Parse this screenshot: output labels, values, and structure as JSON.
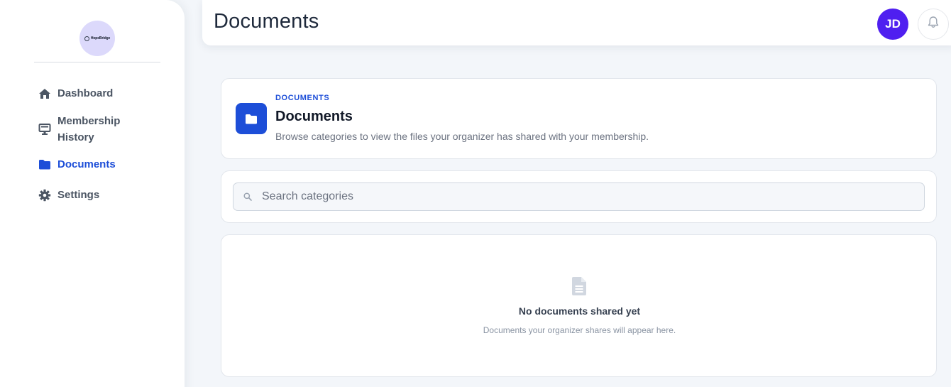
{
  "sidebar": {
    "logo_text": "HopeBridge",
    "items": [
      {
        "label": "Dashboard",
        "icon": "home-icon"
      },
      {
        "label": "Membership History",
        "icon": "monitor-icon"
      },
      {
        "label": "Documents",
        "icon": "folder-icon",
        "active": true
      },
      {
        "label": "Settings",
        "icon": "gear-icon"
      }
    ]
  },
  "header": {
    "title": "Documents",
    "avatar_initials": "JD",
    "notification_icon": "bell-icon"
  },
  "documents_card": {
    "eyebrow": "DOCUMENTS",
    "title": "Documents",
    "subtitle": "Browse categories to view the files your organizer has shared with your membership.",
    "icon": "folder-icon"
  },
  "search": {
    "placeholder": "Search categories",
    "value": "",
    "icon": "search-icon"
  },
  "empty_state": {
    "icon": "document-icon",
    "title": "No documents shared yet",
    "description": "Documents your organizer shares will appear here."
  },
  "colors": {
    "accent": "#1d4ed8",
    "avatar": "#4f1ff0",
    "background": "#f3f6fa"
  }
}
